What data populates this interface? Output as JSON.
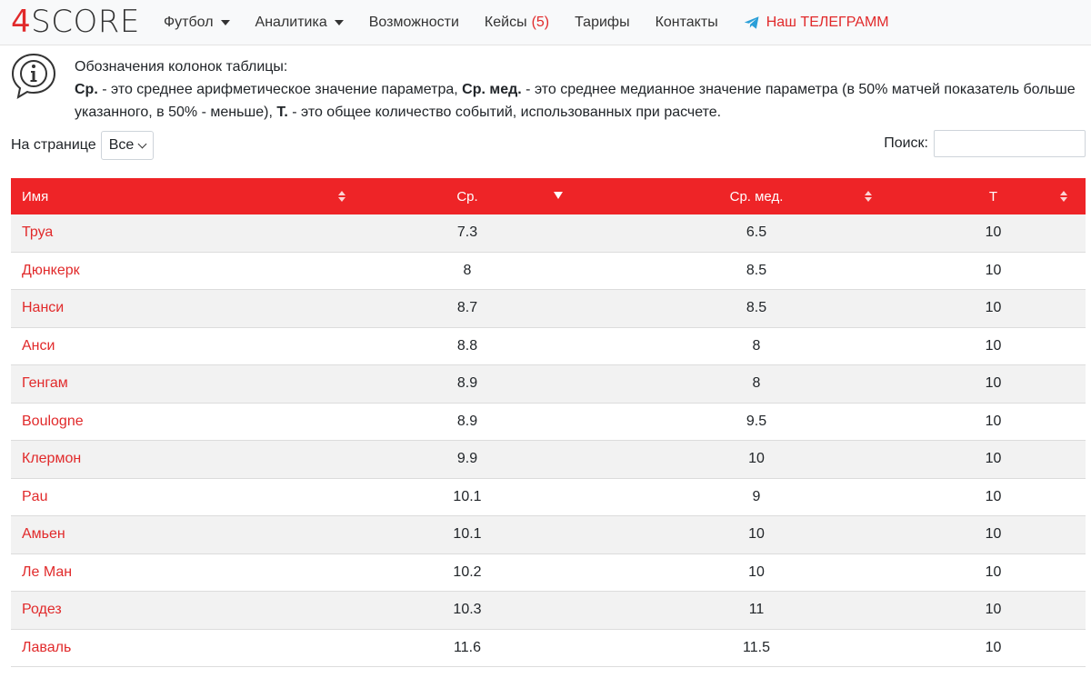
{
  "logo": {
    "part1": "4",
    "part2": "SCORE"
  },
  "nav": {
    "football": "Футбол",
    "analytics": "Аналитика",
    "features": "Возможности",
    "cases": "Кейсы",
    "cases_count": "(5)",
    "pricing": "Тарифы",
    "contacts": "Контакты",
    "telegram": "Наш ТЕЛЕГРАММ"
  },
  "info": {
    "title": "Обозначения колонок таблицы:",
    "avg_key": "Ср.",
    "avg_desc": " - это среднее арифметическое значение параметра, ",
    "med_key": "Ср. мед.",
    "med_desc": " - это среднее медианное значение параметра (в 50% матчей показатель больше указанного, в 50% - меньше), ",
    "total_key": "Т.",
    "total_desc": " - это общее количество событий, использованных при расчете."
  },
  "controls": {
    "per_page_label": "На странице",
    "per_page_value": "Все",
    "search_label": "Поиск:",
    "search_value": ""
  },
  "colors": {
    "accent": "#ee2427",
    "link": "#e12a2b"
  },
  "table": {
    "headers": {
      "name": "Имя",
      "avg": "Ср.",
      "med": "Ср. мед.",
      "total": "Т"
    },
    "sorted_column": "avg",
    "sort_direction": "asc",
    "rows": [
      {
        "name": "Труа",
        "avg": "7.3",
        "med": "6.5",
        "total": "10"
      },
      {
        "name": "Дюнкерк",
        "avg": "8",
        "med": "8.5",
        "total": "10"
      },
      {
        "name": "Нанси",
        "avg": "8.7",
        "med": "8.5",
        "total": "10"
      },
      {
        "name": "Анси",
        "avg": "8.8",
        "med": "8",
        "total": "10"
      },
      {
        "name": "Генгам",
        "avg": "8.9",
        "med": "8",
        "total": "10"
      },
      {
        "name": "Boulogne",
        "avg": "8.9",
        "med": "9.5",
        "total": "10"
      },
      {
        "name": "Клермон",
        "avg": "9.9",
        "med": "10",
        "total": "10"
      },
      {
        "name": "Pau",
        "avg": "10.1",
        "med": "9",
        "total": "10"
      },
      {
        "name": "Амьен",
        "avg": "10.1",
        "med": "10",
        "total": "10"
      },
      {
        "name": "Ле Ман",
        "avg": "10.2",
        "med": "10",
        "total": "10"
      },
      {
        "name": "Родез",
        "avg": "10.3",
        "med": "11",
        "total": "10"
      },
      {
        "name": "Лаваль",
        "avg": "11.6",
        "med": "11.5",
        "total": "10"
      }
    ]
  }
}
